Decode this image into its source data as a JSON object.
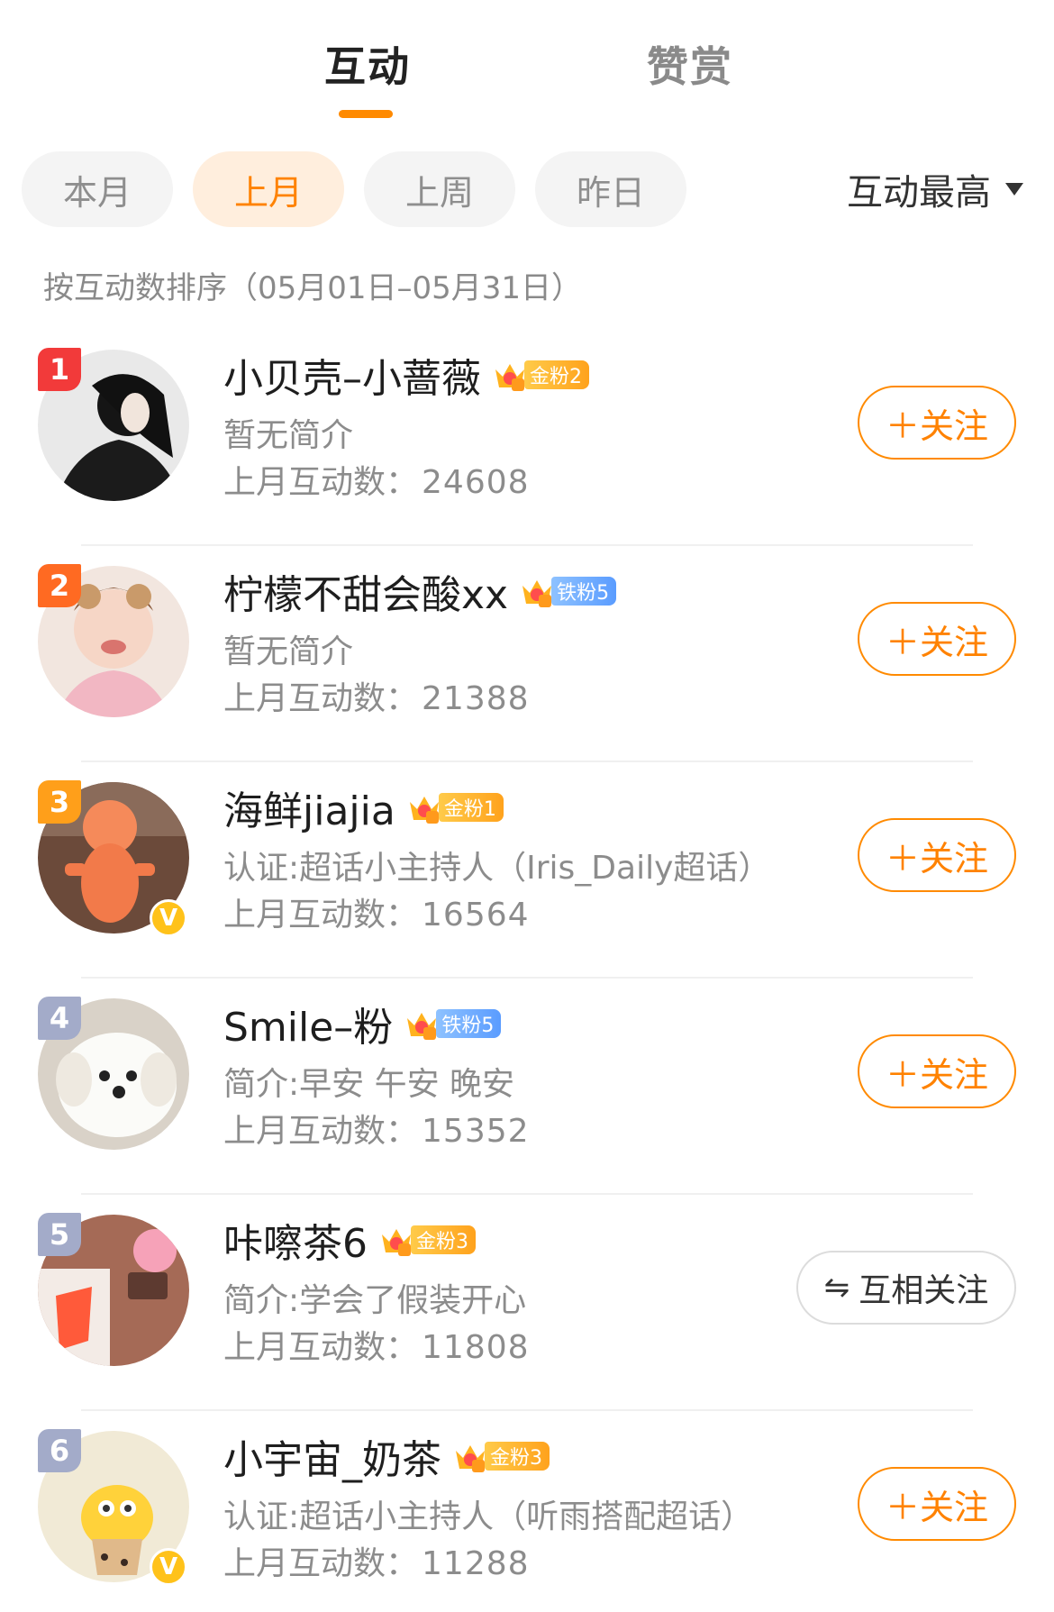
{
  "tabs": [
    {
      "label": "互动",
      "active": true
    },
    {
      "label": "赞赏",
      "active": false
    }
  ],
  "filters": [
    {
      "label": "本月",
      "selected": false
    },
    {
      "label": "上月",
      "selected": true
    },
    {
      "label": "上周",
      "selected": false
    },
    {
      "label": "昨日",
      "selected": false
    }
  ],
  "sort": {
    "label": "互动最高",
    "icon": "caret-down-icon"
  },
  "subtitle": "按互动数排序（05月01日–05月31日）",
  "colors": {
    "accent": "#ff8200",
    "gold_badge": "#ffae2a",
    "iron_badge": "#6aa8ff"
  },
  "users": [
    {
      "rank": "1",
      "name": "小贝壳–小蔷薇",
      "badge": "金粉2",
      "badge_type": "gold",
      "crown_level": "6",
      "desc": "暂无简介",
      "count_label": "上月互动数：",
      "count": "24608",
      "action": "＋关注",
      "verified": false
    },
    {
      "rank": "2",
      "name": "柠檬不甜会酸xx",
      "badge": "铁粉5",
      "badge_type": "iron",
      "crown_level": "6",
      "desc": "暂无简介",
      "count_label": "上月互动数：",
      "count": "21388",
      "action": "＋关注",
      "verified": false
    },
    {
      "rank": "3",
      "name": "海鲜jiajia",
      "badge": "金粉1",
      "badge_type": "gold",
      "crown_level": "4",
      "desc": "认证:超话小主持人（Iris_Daily超话）",
      "count_label": "上月互动数：",
      "count": "16564",
      "action": "＋关注",
      "verified": true,
      "verified_mark": "V"
    },
    {
      "rank": "4",
      "name": "Smile–粉",
      "badge": "铁粉5",
      "badge_type": "iron",
      "crown_level": "6",
      "desc": "简介:早安 午安 晚安",
      "count_label": "上月互动数：",
      "count": "15352",
      "action": "＋关注",
      "verified": false
    },
    {
      "rank": "5",
      "name": "咔嚓茶6",
      "badge": "金粉3",
      "badge_type": "gold",
      "crown_level": "6",
      "desc": "简介:学会了假装开心",
      "count_label": "上月互动数：",
      "count": "11808",
      "action": "互相关注",
      "action_icon": "⇋",
      "verified": false
    },
    {
      "rank": "6",
      "name": "小宇宙_奶茶",
      "badge": "金粉3",
      "badge_type": "gold",
      "crown_level": "6",
      "desc": "认证:超话小主持人（听雨搭配超话）",
      "count_label": "上月互动数：",
      "count": "11288",
      "action": "＋关注",
      "verified": true,
      "verified_mark": "V"
    }
  ]
}
